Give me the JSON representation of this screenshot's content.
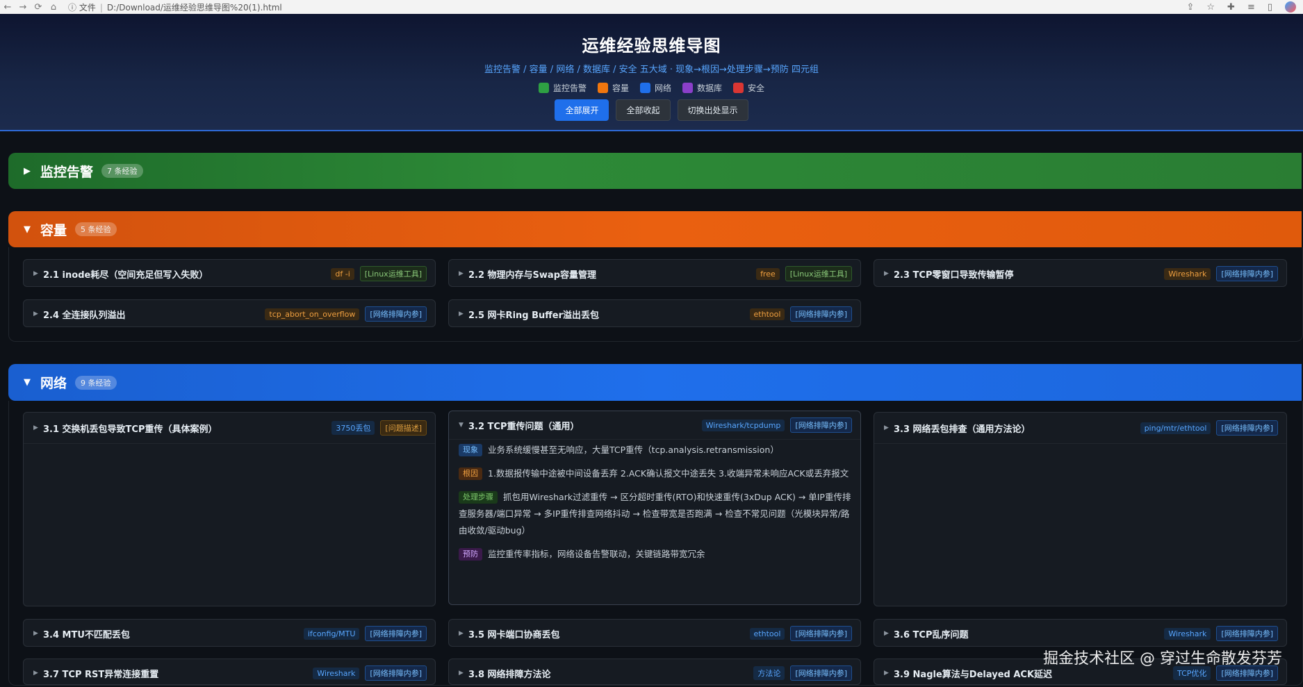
{
  "browser": {
    "address_prefix": "文件",
    "address": "D:/Download/运维经验思维导图%20(1).html"
  },
  "header": {
    "title": "运维经验思维导图",
    "subtitle": "监控告警 / 容量 / 网络 / 数据库 / 安全 五大域 · 现象→根因→处理步骤→预防 四元组",
    "legend": [
      {
        "label": "监控告警",
        "color": "#2ea043"
      },
      {
        "label": "容量",
        "color": "#f0760e"
      },
      {
        "label": "网络",
        "color": "#1f6feb"
      },
      {
        "label": "数据库",
        "color": "#8b3fc9"
      },
      {
        "label": "安全",
        "color": "#da3633"
      }
    ],
    "buttons": {
      "expand_all": "全部展开",
      "collapse_all": "全部收起",
      "toggle_source": "切换出处显示"
    }
  },
  "colors": {
    "monitor": "#2ea043",
    "capacity": "#ea6010",
    "network": "#1f6feb"
  },
  "categories": {
    "monitor": {
      "arrow": "▶",
      "name": "监控告警",
      "count": "7 条经验"
    },
    "capacity": {
      "arrow": "▼",
      "name": "容量",
      "count": "5 条经验"
    },
    "network": {
      "arrow": "▼",
      "name": "网络",
      "count": "9 条经验"
    }
  },
  "capacity_cards": [
    {
      "title": "2.1 inode耗尽（空间充足但写入失败）",
      "tool": "df -i",
      "ref": "[Linux运维工具]"
    },
    {
      "title": "2.2 物理内存与Swap容量管理",
      "tool": "free",
      "ref": "[Linux运维工具]"
    },
    {
      "title": "2.3 TCP零窗口导致传输暂停",
      "tool": "Wireshark",
      "ref": "[网络排障内参]"
    },
    {
      "title": "2.4 全连接队列溢出",
      "tool": "tcp_abort_on_overflow",
      "ref": "[网络排障内参]"
    },
    {
      "title": "2.5 网卡Ring Buffer溢出丢包",
      "tool": "ethtool",
      "ref": "[网络排障内参]"
    }
  ],
  "network_cards": [
    {
      "title": "3.1 交换机丢包导致TCP重传（具体案例）",
      "tool": "3750丢包",
      "ref": "[问题描述]"
    },
    {
      "title": "3.2 TCP重传问题（通用）",
      "tool": "Wireshark/tcpdump",
      "ref": "[网络排障内参]"
    },
    {
      "title": "3.3 网络丢包排查（通用方法论）",
      "tool": "ping/mtr/ethtool",
      "ref": "[网络排障内参]"
    },
    {
      "title": "3.4 MTU不匹配丢包",
      "tool": "ifconfig/MTU",
      "ref": "[网络排障内参]"
    },
    {
      "title": "3.5 网卡端口协商丢包",
      "tool": "ethtool",
      "ref": "[网络排障内参]"
    },
    {
      "title": "3.6 TCP乱序问题",
      "tool": "Wireshark",
      "ref": "[网络排障内参]"
    },
    {
      "title": "3.7 TCP RST异常连接重置",
      "tool": "Wireshark",
      "ref": "[网络排障内参]"
    },
    {
      "title": "3.8 网络排障方法论",
      "tool": "方法论",
      "ref": "[网络排障内参]"
    },
    {
      "title": "3.9 Nagle算法与Delayed ACK延迟",
      "tool": "TCP优化",
      "ref": "[网络排障内参]"
    }
  ],
  "detail_3_2": {
    "symptom_label": "现象",
    "symptom": "业务系统缓慢甚至无响应，大量TCP重传（tcp.analysis.retransmission）",
    "cause_label": "根因",
    "cause": "1.数据报传输中途被中间设备丢弃 2.ACK确认报文中途丢失 3.收端异常未响应ACK或丢弃报文",
    "steps_label": "处理步骤",
    "steps": "抓包用Wireshark过滤重传 → 区分超时重传(RTO)和快速重传(3xDup ACK) → 单IP重传排查服务器/端口异常 → 多IP重传排查网络抖动 → 检查带宽是否跑满 → 检查不常见问题（光模块异常/路由收敛/驱动bug）",
    "prevent_label": "预防",
    "prevent": "监控重传率指标，网络设备告警联动，关键链路带宽冗余"
  },
  "watermark": "掘金技术社区 @ 穿过生命散发芬芳"
}
